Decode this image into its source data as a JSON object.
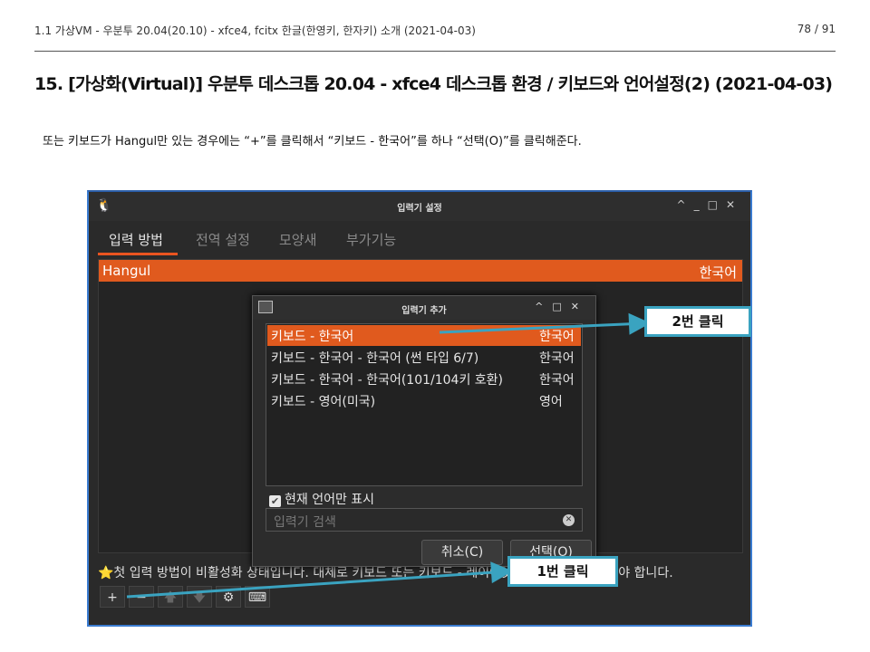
{
  "header": {
    "left": "1.1 가상VM - 우분투 20.04(20.10) - xfce4, fcitx 한글(한영키, 한자키) 소개 (2021-04-03)",
    "page": "78 / 91"
  },
  "title": "15. [가상화(Virtual)] 우분투 데스크톱 20.04 - xfce4 데스크톱 환경 / 키보드와 언어설정(2) (2021-04-03)",
  "intro": "또는 키보드가 Hangul만 있는 경우에는 “+”를 클릭해서 “키보드 - 한국어”를 하나 “선택(O)”를 클릭해준다.",
  "window": {
    "title": "입력기 설정",
    "tabs": [
      "입력 방법",
      "전역 설정",
      "모양새",
      "부가기능"
    ],
    "list_rows": [
      {
        "name": "Hangul",
        "lang": "한국어"
      }
    ],
    "note": "⭐첫 입력 방법이 비활성화 상태입니다. 대체로 키보드 또는 키보드 - 레이아웃 이름 형식으로 하여야 합니다.",
    "toolbar": {
      "add": "+",
      "remove": "−"
    }
  },
  "dialog": {
    "title": "입력기 추가",
    "items": [
      {
        "name": "키보드 - 한국어",
        "lang": "한국어"
      },
      {
        "name": "키보드 - 한국어 - 한국어 (썬 타입 6/7)",
        "lang": "한국어"
      },
      {
        "name": "키보드 - 한국어 - 한국어(101/104키 호환)",
        "lang": "한국어"
      },
      {
        "name": "키보드 - 영어(미국)",
        "lang": "영어"
      }
    ],
    "checkbox_label": "현재 언어만 표시",
    "search_placeholder": "입력기 검색",
    "cancel": "취소(C)",
    "select": "선택(O)"
  },
  "annotations": {
    "step2": "2번 클릭",
    "step1": "1번 클릭",
    "arrow_color": "#3aa3c0"
  },
  "colors": {
    "selection": "#e05a1e",
    "accent": "#e95420"
  }
}
